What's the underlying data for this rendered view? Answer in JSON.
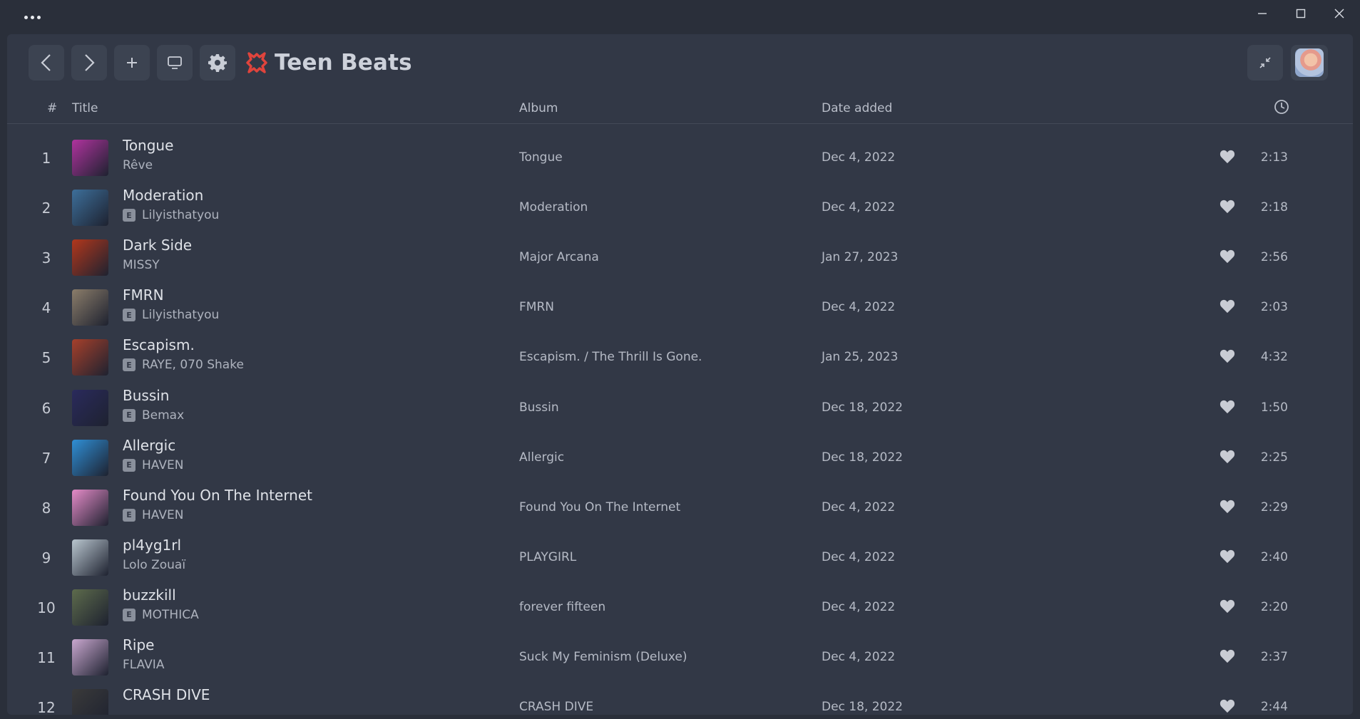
{
  "window": {
    "menu_icon": "more-dots-icon",
    "controls": [
      "minimize-icon",
      "maximize-icon",
      "close-icon"
    ]
  },
  "toolbar": {
    "buttons": [
      "back-icon",
      "forward-icon",
      "add-icon",
      "device-icon",
      "settings-icon"
    ],
    "playlist_icon": "playlist-badge-icon",
    "playlist_title": "Teen Beats",
    "collapse_icon": "collapse-icon",
    "accent_color": "#e0443c"
  },
  "columns": {
    "num": "#",
    "title": "Title",
    "album": "Album",
    "date_added": "Date added",
    "duration_icon": "clock-icon"
  },
  "tracks": [
    {
      "num": "1",
      "title": "Tongue",
      "artist": "Rêve",
      "explicit": false,
      "album": "Tongue",
      "date": "Dec 4, 2022",
      "duration": "2:13"
    },
    {
      "num": "2",
      "title": "Moderation",
      "artist": "Lilyisthatyou",
      "explicit": true,
      "album": "Moderation",
      "date": "Dec 4, 2022",
      "duration": "2:18"
    },
    {
      "num": "3",
      "title": "Dark Side",
      "artist": "MISSY",
      "explicit": false,
      "album": "Major Arcana",
      "date": "Jan 27, 2023",
      "duration": "2:56"
    },
    {
      "num": "4",
      "title": "FMRN",
      "artist": "Lilyisthatyou",
      "explicit": true,
      "album": "FMRN",
      "date": "Dec 4, 2022",
      "duration": "2:03"
    },
    {
      "num": "5",
      "title": "Escapism.",
      "artist": "RAYE, 070 Shake",
      "explicit": true,
      "album": "Escapism. / The Thrill Is Gone.",
      "date": "Jan 25, 2023",
      "duration": "4:32"
    },
    {
      "num": "6",
      "title": "Bussin",
      "artist": "Bemax",
      "explicit": true,
      "album": "Bussin",
      "date": "Dec 18, 2022",
      "duration": "1:50"
    },
    {
      "num": "7",
      "title": "Allergic",
      "artist": "HAVEN",
      "explicit": true,
      "album": "Allergic",
      "date": "Dec 18, 2022",
      "duration": "2:25"
    },
    {
      "num": "8",
      "title": "Found You On The Internet",
      "artist": "HAVEN",
      "explicit": true,
      "album": "Found You On The Internet",
      "date": "Dec 4, 2022",
      "duration": "2:29"
    },
    {
      "num": "9",
      "title": "pl4yg1rl",
      "artist": "Lolo Zouaï",
      "explicit": false,
      "album": "PLAYGIRL",
      "date": "Dec 4, 2022",
      "duration": "2:40"
    },
    {
      "num": "10",
      "title": "buzzkill",
      "artist": "MOTHICA",
      "explicit": true,
      "album": "forever fifteen",
      "date": "Dec 4, 2022",
      "duration": "2:20"
    },
    {
      "num": "11",
      "title": "Ripe",
      "artist": "FLAVIA",
      "explicit": false,
      "album": "Suck My Feminism (Deluxe)",
      "date": "Dec 4, 2022",
      "duration": "2:37"
    },
    {
      "num": "12",
      "title": "CRASH DIVE",
      "artist": "",
      "explicit": false,
      "album": "CRASH DIVE",
      "date": "Dec 18, 2022",
      "duration": "2:44"
    }
  ],
  "explicit_label": "E",
  "cover_colors": [
    "#b0339e",
    "#3d6f9a",
    "#b2371c",
    "#8b7d6a",
    "#a6402b",
    "#2a2a5c",
    "#2f8fd6",
    "#e58bc8",
    "#b9c6cf",
    "#5d6b4c",
    "#c9a7cf",
    "#3a3a3a"
  ]
}
